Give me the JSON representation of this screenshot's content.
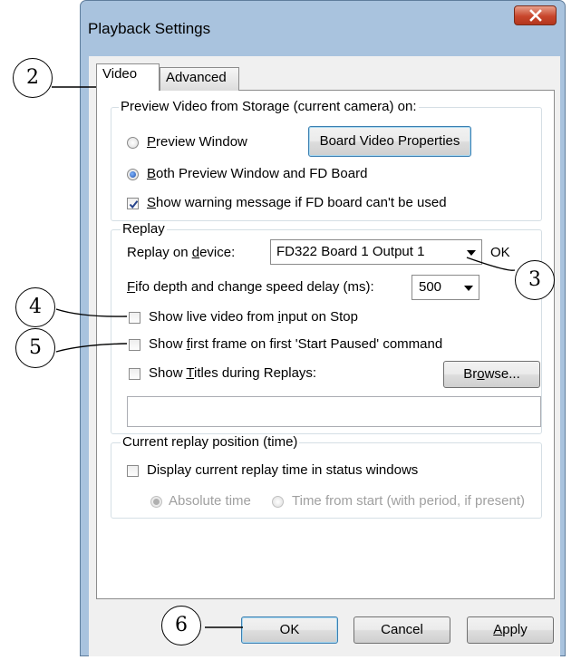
{
  "window": {
    "title": "Playback Settings",
    "close_icon": "close-x-icon"
  },
  "tabs": [
    {
      "label": "Video",
      "active": true
    },
    {
      "label": "Advanced",
      "active": false
    }
  ],
  "preview_group": {
    "legend": "Preview Video from Storage (current camera) on:",
    "options": [
      {
        "label_pre": "",
        "accel": "P",
        "label_post": "review Window",
        "checked": false
      },
      {
        "label_pre": "",
        "accel": "B",
        "label_post": "oth Preview Window and FD Board",
        "checked": true
      }
    ],
    "board_button": "Board Video Properties",
    "warning_check": {
      "label_pre": "",
      "accel": "S",
      "label_post": "how warning message if FD board can't be used",
      "checked": true
    }
  },
  "replay_group": {
    "legend": "Replay",
    "device_label_pre": "Replay on ",
    "device_accel": "d",
    "device_label_post": "evice:",
    "device_value": "FD322 Board 1 Output 1",
    "device_status": "OK",
    "fifo_label_pre": "",
    "fifo_accel": "F",
    "fifo_label_post": "ifo depth and change speed delay (ms):",
    "fifo_value": "500",
    "live_check": {
      "label_pre": "Show live video from ",
      "accel": "i",
      "label_post": "nput on Stop",
      "checked": false
    },
    "first_frame_check": {
      "label_pre": "Show ",
      "accel": "f",
      "label_post": "irst frame on first 'Start Paused' command",
      "checked": false
    },
    "titles_check": {
      "label_pre": "Show ",
      "accel": "T",
      "label_post": "itles during Replays:",
      "checked": false
    },
    "browse_button_pre": "Br",
    "browse_accel": "o",
    "browse_button_post": "wse...",
    "titles_path": ""
  },
  "position_group": {
    "legend": "Current replay position (time)",
    "display_check": {
      "label": "Display current replay time in status windows",
      "checked": false
    },
    "modes": [
      {
        "label": "Absolute time",
        "checked": true,
        "enabled": false
      },
      {
        "label": "Time from start (with period, if present)",
        "checked": false,
        "enabled": false
      }
    ]
  },
  "footer": {
    "ok": "OK",
    "cancel": "Cancel",
    "apply_accel": "A",
    "apply_post": "pply"
  },
  "callouts": [
    "2",
    "3",
    "4",
    "5",
    "6"
  ]
}
